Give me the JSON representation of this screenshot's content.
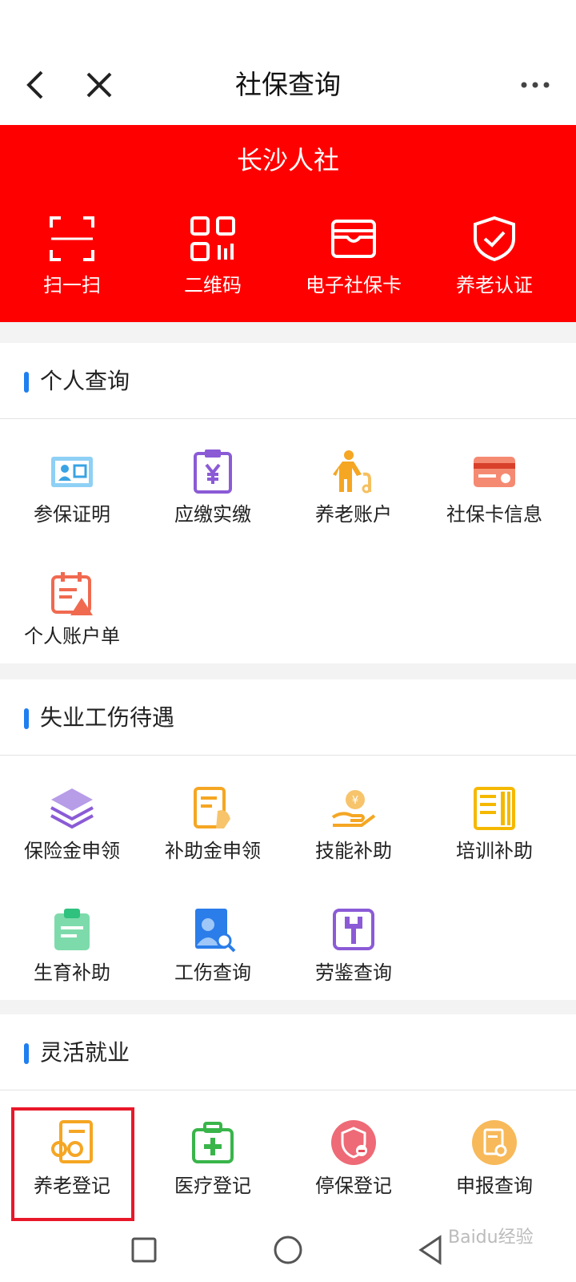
{
  "header": {
    "title": "社保查询",
    "back_icon": "chevron-left-icon",
    "close_icon": "close-icon",
    "more_icon": "more-dots-icon"
  },
  "banner": {
    "title": "长沙人社",
    "bg_color": "#ff0000",
    "items": [
      {
        "label": "扫一扫",
        "icon": "scan-icon"
      },
      {
        "label": "二维码",
        "icon": "qrcode-icon"
      },
      {
        "label": "电子社保卡",
        "icon": "wallet-card-icon"
      },
      {
        "label": "养老认证",
        "icon": "shield-check-icon"
      }
    ]
  },
  "sections": [
    {
      "title": "个人查询",
      "items": [
        {
          "label": "参保证明",
          "icon": "id-card-icon",
          "color": "#3aa3e3"
        },
        {
          "label": "应缴实缴",
          "icon": "clipboard-yen-icon",
          "color": "#8b5bd6"
        },
        {
          "label": "养老账户",
          "icon": "elderly-person-icon",
          "color": "#f5a623"
        },
        {
          "label": "社保卡信息",
          "icon": "credit-card-icon",
          "color": "#f06a50"
        },
        {
          "label": "个人账户单",
          "icon": "calendar-warning-icon",
          "color": "#f06a50"
        }
      ]
    },
    {
      "title": "失业工伤待遇",
      "items": [
        {
          "label": "保险金申领",
          "icon": "layers-icon",
          "color": "#8b5bd6"
        },
        {
          "label": "补助金申领",
          "icon": "document-hand-icon",
          "color": "#f5a623"
        },
        {
          "label": "技能补助",
          "icon": "coin-hand-icon",
          "color": "#f5a623"
        },
        {
          "label": "培训补助",
          "icon": "book-icon",
          "color": "#f5b800"
        },
        {
          "label": "生育补助",
          "icon": "clipboard-list-icon",
          "color": "#2ec27e"
        },
        {
          "label": "工伤查询",
          "icon": "person-search-icon",
          "color": "#2b7de9"
        },
        {
          "label": "劳鉴查询",
          "icon": "wrench-icon",
          "color": "#8b5bd6"
        }
      ]
    },
    {
      "title": "灵活就业",
      "items": [
        {
          "label": "养老登记",
          "icon": "glasses-document-icon",
          "color": "#f5a623"
        },
        {
          "label": "医疗登记",
          "icon": "medical-kit-icon",
          "color": "#39b54a"
        },
        {
          "label": "停保登记",
          "icon": "shield-minus-icon",
          "color": "#e84b5b"
        },
        {
          "label": "申报查询",
          "icon": "document-search-icon",
          "color": "#f5a623"
        }
      ]
    }
  ],
  "highlight_color": "#e8182a",
  "nav": {
    "items": [
      {
        "icon": "square-icon"
      },
      {
        "icon": "circle-icon"
      },
      {
        "icon": "triangle-back-icon"
      }
    ]
  },
  "watermark": "Baidu经验"
}
